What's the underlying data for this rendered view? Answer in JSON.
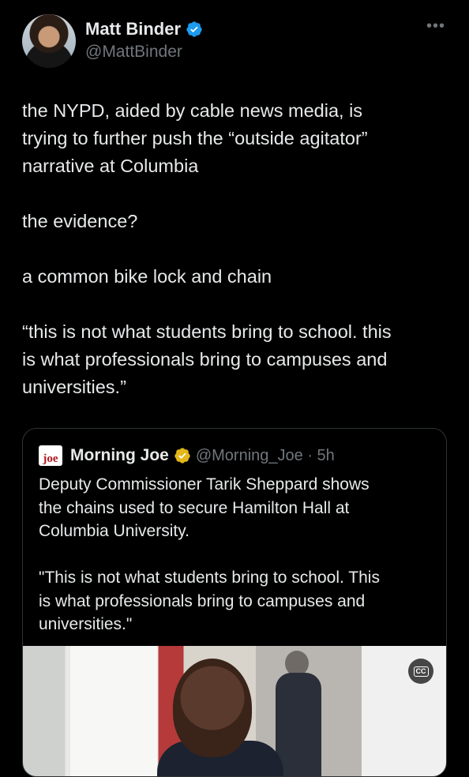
{
  "author": {
    "name": "Matt Binder",
    "handle": "@MattBinder",
    "verified_color": "#1d9bf0"
  },
  "more_icon": "•••",
  "tweet": {
    "text": "the NYPD, aided by cable news media, is\ntrying to further push the “outside agitator”\nnarrative at Columbia\n\nthe evidence?\n\na common bike lock and chain\n\n“this is not what students bring to school. this\nis what professionals bring to campuses and\nuniversities.”"
  },
  "quote": {
    "logo_text": "joe",
    "name": "Morning Joe",
    "badge_color": "#e2b719",
    "handle_time": "@Morning_Joe · 5h",
    "text": "Deputy Commissioner Tarik Sheppard shows\nthe chains used to secure Hamilton Hall at\nColumbia University.\n\n\"This is not what students bring to school. This\nis what professionals bring to campuses and\nuniversities.\"",
    "media": {
      "cc_label": "CC"
    }
  }
}
